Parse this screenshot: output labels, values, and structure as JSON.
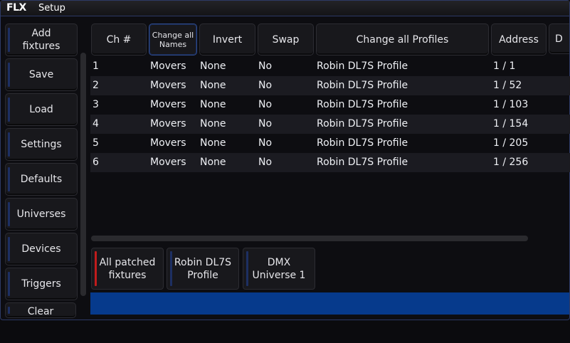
{
  "app": {
    "logo": "FLX",
    "title": "Setup"
  },
  "sidebar": [
    {
      "label": "Add fixtures"
    },
    {
      "label": "Save"
    },
    {
      "label": "Load"
    },
    {
      "label": "Settings"
    },
    {
      "label": "Defaults"
    },
    {
      "label": "Universes"
    },
    {
      "label": "Devices"
    },
    {
      "label": "Triggers"
    },
    {
      "label": "Clear"
    }
  ],
  "headers": {
    "ch": "Ch #",
    "names": "Change all Names",
    "invert": "Invert",
    "swap": "Swap",
    "profiles": "Change all Profiles",
    "address": "Address",
    "extra": "D"
  },
  "rows": [
    {
      "ch": "1",
      "name": "Movers",
      "invert": "None",
      "swap": "No",
      "profile": "Robin DL7S Profile",
      "address": "1 / 1"
    },
    {
      "ch": "2",
      "name": "Movers",
      "invert": "None",
      "swap": "No",
      "profile": "Robin DL7S Profile",
      "address": "1 / 52"
    },
    {
      "ch": "3",
      "name": "Movers",
      "invert": "None",
      "swap": "No",
      "profile": "Robin DL7S Profile",
      "address": "1 / 103"
    },
    {
      "ch": "4",
      "name": "Movers",
      "invert": "None",
      "swap": "No",
      "profile": "Robin DL7S Profile",
      "address": "1 / 154"
    },
    {
      "ch": "5",
      "name": "Movers",
      "invert": "None",
      "swap": "No",
      "profile": "Robin DL7S Profile",
      "address": "1 / 205"
    },
    {
      "ch": "6",
      "name": "Movers",
      "invert": "None",
      "swap": "No",
      "profile": "Robin DL7S Profile",
      "address": "1 / 256"
    }
  ],
  "filters": [
    {
      "label": "All patched fixtures",
      "accent": "#c01c1c"
    },
    {
      "label": "Robin DL7S Profile",
      "accent": "#1d2f62"
    },
    {
      "label": "DMX Universe 1",
      "accent": "#1d2f62"
    }
  ],
  "colors": {
    "accent_blue": "#063a8c",
    "header_highlight": "#2e4a8a"
  }
}
